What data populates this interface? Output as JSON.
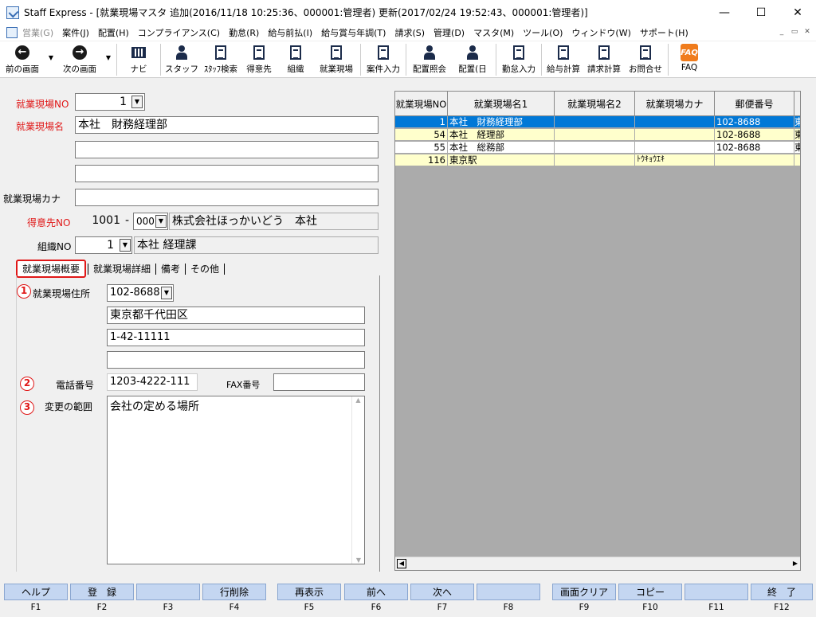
{
  "window": {
    "title": "Staff Express - [就業現場マスタ 追加(2016/11/18 10:25:36、000001:管理者) 更新(2017/02/24 19:52:43、000001:管理者)]",
    "controls": [
      "—",
      "☐",
      "✕"
    ]
  },
  "menu": [
    {
      "label": "営業(G)",
      "disabled": true
    },
    {
      "label": "案件(J)"
    },
    {
      "label": "配置(H)"
    },
    {
      "label": "コンプライアンス(C)"
    },
    {
      "label": "勤怠(R)"
    },
    {
      "label": "給与前払(I)"
    },
    {
      "label": "給与賞与年調(T)"
    },
    {
      "label": "請求(S)"
    },
    {
      "label": "管理(D)"
    },
    {
      "label": "マスタ(M)"
    },
    {
      "label": "ツール(O)"
    },
    {
      "label": "ウィンドウ(W)"
    },
    {
      "label": "サポート(H)"
    }
  ],
  "toolbar": {
    "back": "前の画面",
    "next": "次の画面",
    "navi": "ナビ",
    "staff": "スタッフ",
    "staff_search": "ｽﾀｯﾌ検索",
    "client": "得意先",
    "org": "組織",
    "site": "就業現場",
    "case_input": "案件入力",
    "assign_query": "配置照会",
    "assign_day": "配置(日",
    "attendance": "勤怠入力",
    "payroll": "給与計算",
    "billing": "請求計算",
    "inquiry": "お問合せ",
    "faq": "FAQ",
    "faq_icon": "FAQ"
  },
  "form": {
    "site_no_label": "就業現場NO",
    "site_no": "1",
    "site_name_label": "就業現場名",
    "site_name_1": "本社　財務経理部",
    "site_name_2": "",
    "site_name_3": "",
    "kana_label": "就業現場カナ",
    "kana": "",
    "client_no_label": "得意先NO",
    "client_no": "1001",
    "client_dash": "-",
    "client_branch": "000",
    "client_name": "株式会社ほっかいどう　本社",
    "org_no_label": "組織NO",
    "org_no": "1",
    "org_name": "本社 経理課"
  },
  "tabs": [
    "就業現場概要",
    "就業現場詳細",
    "備考",
    "その他"
  ],
  "overview": {
    "marker1": "1",
    "marker2": "2",
    "marker3": "3",
    "address_label": "就業現場住所",
    "postal": "102-8688",
    "address1": "東京都千代田区",
    "address2": "1-42-11111",
    "address3": "",
    "phone_label": "電話番号",
    "phone": "1203-4222-111",
    "fax_label": "FAX番号",
    "fax": "",
    "scope_label": "変更の範囲",
    "scope": "会社の定める場所"
  },
  "grid": {
    "headers": [
      "就業現場NO",
      "就業現場名1",
      "就業現場名2",
      "就業現場カナ",
      "郵便番号",
      ""
    ],
    "rows": [
      {
        "no": "1",
        "name1": "本社　財務経理部",
        "name2": "",
        "kana": "",
        "postal": "102-8688",
        "extra": "東",
        "style": "selected"
      },
      {
        "no": "54",
        "name1": "本社　経理部",
        "name2": "",
        "kana": "",
        "postal": "102-8688",
        "extra": "東",
        "style": "yellow"
      },
      {
        "no": "55",
        "name1": "本社　総務部",
        "name2": "",
        "kana": "",
        "postal": "102-8688",
        "extra": "東",
        "style": "white"
      },
      {
        "no": "116",
        "name1": "東京駅",
        "name2": "",
        "kana": "ﾄｳｷｮｳｴｷ",
        "postal": "",
        "extra": "",
        "style": "yellow"
      }
    ]
  },
  "fkeys": [
    {
      "label": "ヘルプ",
      "key": "F1"
    },
    {
      "label": "登　録",
      "key": "F2"
    },
    {
      "label": "",
      "key": "F3"
    },
    {
      "label": "行削除",
      "key": "F4"
    },
    {
      "label": "再表示",
      "key": "F5"
    },
    {
      "label": "前へ",
      "key": "F6"
    },
    {
      "label": "次へ",
      "key": "F7"
    },
    {
      "label": "",
      "key": "F8"
    },
    {
      "label": "画面クリア",
      "key": "F9"
    },
    {
      "label": "コピー",
      "key": "F10"
    },
    {
      "label": "",
      "key": "F11"
    },
    {
      "label": "終　了",
      "key": "F12"
    }
  ],
  "colors": {
    "accent": "#0078d7",
    "required_label": "#e01818",
    "row_yellow": "#ffffcc",
    "fkey": "#c4d6f1"
  }
}
